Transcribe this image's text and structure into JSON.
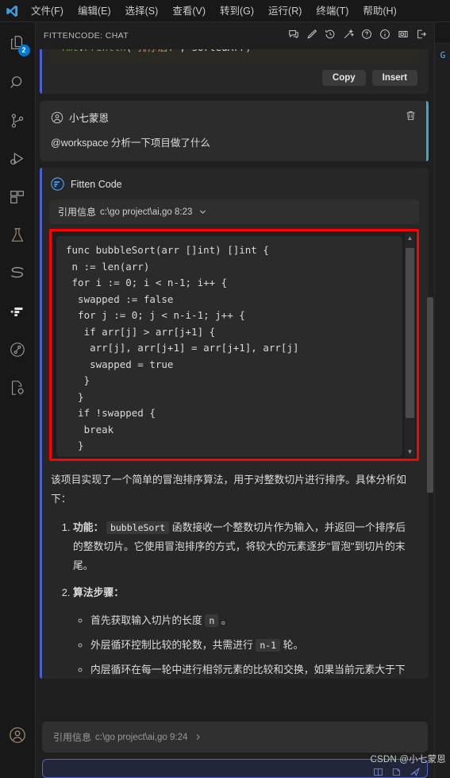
{
  "titlebar": {
    "logo_icon": "vscode-logo-icon",
    "menu": [
      {
        "label": "文件(F)",
        "name": "menu-file"
      },
      {
        "label": "编辑(E)",
        "name": "menu-edit"
      },
      {
        "label": "选择(S)",
        "name": "menu-selection"
      },
      {
        "label": "查看(V)",
        "name": "menu-view"
      },
      {
        "label": "转到(G)",
        "name": "menu-go"
      },
      {
        "label": "运行(R)",
        "name": "menu-run"
      },
      {
        "label": "终端(T)",
        "name": "menu-terminal"
      },
      {
        "label": "帮助(H)",
        "name": "menu-help"
      }
    ]
  },
  "activitybar": {
    "items": [
      {
        "icon": "explorer-icon",
        "badge": "2"
      },
      {
        "icon": "search-icon",
        "badge": ""
      },
      {
        "icon": "source-control-icon",
        "badge": ""
      },
      {
        "icon": "run-and-debug-icon",
        "badge": ""
      },
      {
        "icon": "extensions-icon",
        "badge": ""
      },
      {
        "icon": "testing-flask-icon",
        "badge": ""
      },
      {
        "icon": "snake-s-icon",
        "badge": ""
      },
      {
        "icon": "fitten-code-icon",
        "badge": ""
      },
      {
        "icon": "graph-circle-icon",
        "badge": ""
      },
      {
        "icon": "cpp-settings-icon",
        "badge": ""
      }
    ],
    "account_icon": "account-icon"
  },
  "panel": {
    "title": "FITTENCODE: CHAT",
    "header_actions": [
      {
        "icon": "new-chat-icon",
        "title": "新建对话"
      },
      {
        "icon": "edit-pencil-icon",
        "title": "编辑"
      },
      {
        "icon": "history-icon",
        "title": "历史记录"
      },
      {
        "icon": "magic-wand-icon",
        "title": "智能操作"
      },
      {
        "icon": "help-question-icon",
        "title": "帮助"
      },
      {
        "icon": "info-icon",
        "title": "信息"
      },
      {
        "icon": "close-panel-icon",
        "title": "关闭"
      },
      {
        "icon": "open-in-editor-icon",
        "title": "在编辑器中打开"
      }
    ]
  },
  "top_code_card": {
    "lines": [
      "}",
      "fmt.Println(\"排序后:\", sortedArr)"
    ],
    "copy_label": "Copy",
    "insert_label": "Insert"
  },
  "user_message": {
    "avatar_icon": "account-circle-icon",
    "name": "小七蒙恩",
    "delete_icon": "trash-icon",
    "text": "@workspace 分析一下项目做了什么"
  },
  "assistant_message": {
    "logo_icon": "fitten-code-logo-icon",
    "name": "Fitten Code",
    "reference": {
      "label": "引用信息",
      "path": "c:\\go project\\ai,go 8:23",
      "chevron_icon": "chevron-down-icon"
    },
    "code_block": {
      "code": "func bubbleSort(arr []int) []int {\n n := len(arr)\n for i := 0; i < n-1; i++ {\n  swapped := false\n  for j := 0; j < n-i-1; j++ {\n   if arr[j] > arr[j+1] {\n    arr[j], arr[j+1] = arr[j+1], arr[j]\n    swapped = true\n   }\n  }\n  if !swapped {\n   break\n  }",
      "highlight_color": "#ff0000",
      "scroll_up_icon": "scroll-up-arrow-icon",
      "scroll_down_icon": "scroll-down-arrow-icon"
    },
    "intro": "该项目实现了一个简单的冒泡排序算法，用于对整数切片进行排序。具体分析如下：",
    "steps": [
      {
        "bold_prefix": "功能：",
        "code_token": "bubbleSort",
        "rest": "函数接收一个整数切片作为输入，并返回一个排序后的整数切片。它使用冒泡排序的方式，将较大的元素逐步\"冒泡\"到切片的末尾。",
        "substeps": []
      },
      {
        "bold_prefix": "算法步骤：",
        "code_token": "",
        "rest": "",
        "substeps": [
          {
            "before": "首先获取输入切片的长度 ",
            "code": "n",
            "after": " 。"
          },
          {
            "before": "外层循环控制比较的轮数，共需进行 ",
            "code": "n-1",
            "after": " 轮。"
          },
          {
            "before": "内层循环在每一轮中进行相邻元素的比较和交换，如果当前元素大于下",
            "code": "",
            "after": ""
          }
        ]
      }
    ]
  },
  "composer": {
    "reference_label": "引用信息",
    "reference_path": "c:\\go project\\ai,go 9:24",
    "chevron_icon": "chevron-right-icon",
    "input_placeholder": "",
    "input_value": "",
    "tool_icons": [
      "split-view-icon",
      "attach-file-icon",
      "send-icon"
    ]
  },
  "watermark": {
    "text": "CSDN @小七蒙恩"
  },
  "colors": {
    "accent_blue": "#0078d4",
    "user_accent": "#3ea6c8",
    "assistant_accent": "#4a5fd4",
    "highlight_red": "#ff0000",
    "panel_bg": "#1f1f1f",
    "msg_bg": "#272727"
  }
}
